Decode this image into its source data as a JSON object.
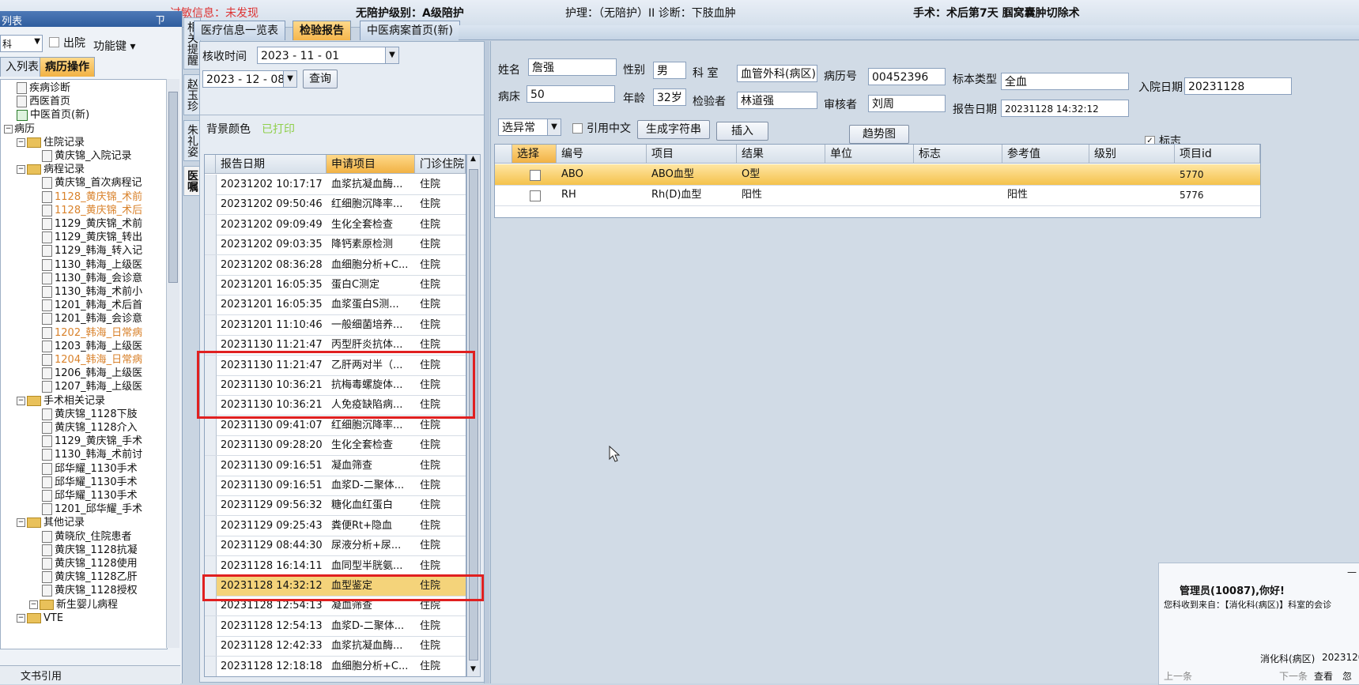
{
  "topbar": {
    "alert": "过敏信息：未发现",
    "care": "无陪护级别：A级陪护",
    "nursing": "护理：（无陪护）II 诊断：下肢血肿",
    "surgery": "手术：术后第7天 腘窝囊肿切除术"
  },
  "left": {
    "title": "列表",
    "pin": "ㄗ",
    "combo_value": "科",
    "discharge_label": "出院",
    "function_key": "功能键",
    "tab_list": "入列表",
    "tab_ops": "病历操作",
    "tree": [
      {
        "label": "疾病诊断",
        "level": 1,
        "kind": "doc"
      },
      {
        "label": "西医首页",
        "level": 1,
        "kind": "doc"
      },
      {
        "label": "中医首页(新)",
        "level": 1,
        "kind": "check"
      },
      {
        "label": "病历",
        "level": 0,
        "kind": "root"
      },
      {
        "label": "住院记录",
        "level": 1,
        "kind": "folder"
      },
      {
        "label": "黄庆锦_入院记录",
        "level": 3,
        "kind": "doc"
      },
      {
        "label": "病程记录",
        "level": 1,
        "kind": "folder"
      },
      {
        "label": "黄庆锦_首次病程记",
        "level": 3,
        "kind": "doc"
      },
      {
        "label": "1128_黄庆锦_术前",
        "level": 3,
        "kind": "doc",
        "orange": true
      },
      {
        "label": "1128_黄庆锦_术后",
        "level": 3,
        "kind": "doc",
        "orange": true
      },
      {
        "label": "1129_黄庆锦_术前",
        "level": 3,
        "kind": "doc"
      },
      {
        "label": "1129_黄庆锦_转出",
        "level": 3,
        "kind": "doc"
      },
      {
        "label": "1129_韩海_转入记",
        "level": 3,
        "kind": "doc"
      },
      {
        "label": "1130_韩海_上级医",
        "level": 3,
        "kind": "doc"
      },
      {
        "label": "1130_韩海_会诊意",
        "level": 3,
        "kind": "doc"
      },
      {
        "label": "1130_韩海_术前小",
        "level": 3,
        "kind": "doc"
      },
      {
        "label": "1201_韩海_术后首",
        "level": 3,
        "kind": "doc"
      },
      {
        "label": "1201_韩海_会诊意",
        "level": 3,
        "kind": "doc"
      },
      {
        "label": "1202_韩海_日常病",
        "level": 3,
        "kind": "doc",
        "orange": true
      },
      {
        "label": "1203_韩海_上级医",
        "level": 3,
        "kind": "doc"
      },
      {
        "label": "1204_韩海_日常病",
        "level": 3,
        "kind": "doc",
        "orange": true
      },
      {
        "label": "1206_韩海_上级医",
        "level": 3,
        "kind": "doc"
      },
      {
        "label": "1207_韩海_上级医",
        "level": 3,
        "kind": "doc"
      },
      {
        "label": "手术相关记录",
        "level": 1,
        "kind": "folder"
      },
      {
        "label": "黄庆锦_1128下肢",
        "level": 3,
        "kind": "doc"
      },
      {
        "label": "黄庆锦_1128介入",
        "level": 3,
        "kind": "doc"
      },
      {
        "label": "1129_黄庆锦_手术",
        "level": 3,
        "kind": "doc"
      },
      {
        "label": "1130_韩海_术前讨",
        "level": 3,
        "kind": "doc"
      },
      {
        "label": "邱华耀_1130手术",
        "level": 3,
        "kind": "doc"
      },
      {
        "label": "邱华耀_1130手术",
        "level": 3,
        "kind": "doc"
      },
      {
        "label": "邱华耀_1130手术",
        "level": 3,
        "kind": "doc"
      },
      {
        "label": "1201_邱华耀_手术",
        "level": 3,
        "kind": "doc"
      },
      {
        "label": "其他记录",
        "level": 1,
        "kind": "folder"
      },
      {
        "label": "黄晓欣_住院患者",
        "level": 3,
        "kind": "doc"
      },
      {
        "label": "黄庆锦_1128抗凝",
        "level": 3,
        "kind": "doc"
      },
      {
        "label": "黄庆锦_1128使用",
        "level": 3,
        "kind": "doc"
      },
      {
        "label": "黄庆锦_1128乙肝",
        "level": 3,
        "kind": "doc"
      },
      {
        "label": "黄庆锦_1128授权",
        "level": 3,
        "kind": "doc"
      },
      {
        "label": "新生婴儿病程",
        "level": 2,
        "kind": "folder"
      },
      {
        "label": "VTE",
        "level": 1,
        "kind": "folder"
      }
    ],
    "bottom_label": "文书引用"
  },
  "sidetabs": [
    "相关提醒",
    "赵玉珍",
    "朱礼姿",
    "医嘱"
  ],
  "tabs": [
    {
      "label": "医疗信息一览表",
      "active": false
    },
    {
      "label": "检验报告",
      "active": true
    },
    {
      "label": "中医病案首页(新)",
      "active": false
    }
  ],
  "query": {
    "receive_time_label": "核收时间",
    "date_from": "2023 - 11 - 01",
    "date_to": "2023 - 12 - 08",
    "query_button": "查询",
    "bg_color_label": "背景颜色",
    "printed_label": "已打印"
  },
  "report_list": {
    "headers": [
      "报告日期",
      "申请项目",
      "门诊住院"
    ],
    "rows": [
      {
        "date": "20231202 10:17:17",
        "item": "血浆抗凝血酶...",
        "type": "住院"
      },
      {
        "date": "20231202 09:50:46",
        "item": "红细胞沉降率...",
        "type": "住院"
      },
      {
        "date": "20231202 09:09:49",
        "item": "生化全套检查",
        "type": "住院"
      },
      {
        "date": "20231202 09:03:35",
        "item": "降钙素原检测",
        "type": "住院"
      },
      {
        "date": "20231202 08:36:28",
        "item": "血细胞分析+C...",
        "type": "住院"
      },
      {
        "date": "20231201 16:05:35",
        "item": "蛋白C测定",
        "type": "住院"
      },
      {
        "date": "20231201 16:05:35",
        "item": "血浆蛋白S测...",
        "type": "住院"
      },
      {
        "date": "20231201 11:10:46",
        "item": "一般细菌培养...",
        "type": "住院"
      },
      {
        "date": "20231130 11:21:47",
        "item": "丙型肝炎抗体...",
        "type": "住院"
      },
      {
        "date": "20231130 11:21:47",
        "item": "乙肝两对半（...",
        "type": "住院"
      },
      {
        "date": "20231130 10:36:21",
        "item": "抗梅毒螺旋体...",
        "type": "住院"
      },
      {
        "date": "20231130 10:36:21",
        "item": "人免疫缺陷病...",
        "type": "住院"
      },
      {
        "date": "20231130 09:41:07",
        "item": "红细胞沉降率...",
        "type": "住院"
      },
      {
        "date": "20231130 09:28:20",
        "item": "生化全套检查",
        "type": "住院"
      },
      {
        "date": "20231130 09:16:51",
        "item": "凝血筛查",
        "type": "住院"
      },
      {
        "date": "20231130 09:16:51",
        "item": "血浆D-二聚体...",
        "type": "住院"
      },
      {
        "date": "20231129 09:56:32",
        "item": "糖化血红蛋白",
        "type": "住院"
      },
      {
        "date": "20231129 09:25:43",
        "item": "粪便Rt+隐血",
        "type": "住院"
      },
      {
        "date": "20231129 08:44:30",
        "item": "尿液分析+尿...",
        "type": "住院"
      },
      {
        "date": "20231128 16:14:11",
        "item": "血同型半胱氨...",
        "type": "住院"
      },
      {
        "date": "20231128 14:32:12",
        "item": "血型鉴定",
        "type": "住院",
        "highlight": true
      },
      {
        "date": "20231128 12:54:13",
        "item": "凝血筛查",
        "type": "住院"
      },
      {
        "date": "20231128 12:54:13",
        "item": "血浆D-二聚体...",
        "type": "住院"
      },
      {
        "date": "20231128 12:42:33",
        "item": "血浆抗凝血酶...",
        "type": "住院"
      },
      {
        "date": "20231128 12:18:18",
        "item": "血细胞分析+C...",
        "type": "住院"
      }
    ]
  },
  "patient": {
    "name_label": "姓名",
    "name": "詹强",
    "sex_label": "性别",
    "sex": "男",
    "dept_label": "科 室",
    "dept": "血管外科(病区)",
    "record_no_label": "病历号",
    "record_no": "00452396",
    "specimen_label": "标本类型",
    "specimen": "全血",
    "admit_label": "入院日期",
    "admit_date": "20231128",
    "bed_label": "病床",
    "bed": "50",
    "age_label": "年龄",
    "age": "32岁",
    "inspector_label": "检验者",
    "inspector": "林道强",
    "reviewer_label": "审核者",
    "reviewer": "刘周",
    "report_date_label": "报告日期",
    "report_date": "20231128 14:32:12"
  },
  "toolbar": {
    "filter_value": "选异常",
    "cite_chinese": "引用中文",
    "gen_string": "生成字符串",
    "insert": "插入",
    "trend": "趋势图",
    "flag_check": "标志"
  },
  "results": {
    "headers": [
      "选择",
      "编号",
      "项目",
      "结果",
      "单位",
      "标志",
      "参考值",
      "级别",
      "项目id"
    ],
    "rows": [
      {
        "code": "ABO",
        "item": "ABO血型",
        "result": "O型",
        "unit": "",
        "flag": "",
        "ref": "",
        "level": "",
        "id": "5770",
        "highlight": true
      },
      {
        "code": "RH",
        "item": "Rh(D)血型",
        "result": "阳性",
        "unit": "",
        "flag": "",
        "ref": "阳性",
        "level": "",
        "id": "5776"
      }
    ]
  },
  "notification": {
    "greeting": "管理员(10087),你好!",
    "message": "您科收到来自：【消化科(病区)】科室的会诊",
    "dept": "消化科(病区)",
    "time": "2023120",
    "prev": "上一条",
    "next": "下一条",
    "view": "查看",
    "ignore": "忽"
  }
}
